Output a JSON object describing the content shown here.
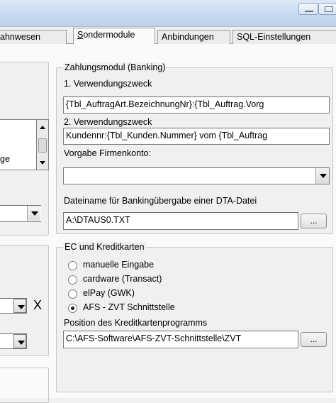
{
  "tabs": [
    {
      "label": "ahnwesen"
    },
    {
      "label_first": "S",
      "label_rest": "ondermodule"
    },
    {
      "label": "Anbindungen"
    },
    {
      "label": "SQL-Einstellungen"
    }
  ],
  "left": {
    "list_fragment": "ge",
    "close_glyph": "X"
  },
  "banking": {
    "legend": "Zahlungsmodul (Banking)",
    "purpose1_label": "1. Verwendungszweck",
    "purpose1_value": "{Tbl_AuftragArt.BezeichnungNr}:{Tbl_Auftrag.Vorg",
    "purpose2_label": "2. Verwendungszweck",
    "purpose2_value": "Kundennr:{Tbl_Kunden.Nummer} vom {Tbl_Auftrag",
    "account_label": "Vorgabe Firmenkonto:",
    "account_value": "",
    "filename_label": "Dateiname für Bankingübergabe einer DTA-Datei",
    "filename_value": "A:\\DTAUS0.TXT",
    "browse_label": "..."
  },
  "ec": {
    "legend": "EC und Kreditkarten",
    "options": [
      {
        "label": "manuelle Eingabe",
        "selected": false
      },
      {
        "label": "cardware (Transact)",
        "selected": false
      },
      {
        "label": "elPay (GWK)",
        "selected": false
      },
      {
        "label": "AFS - ZVT Schnittstelle",
        "selected": true
      }
    ],
    "path_label": "Position des Kreditkartenprogramms",
    "path_value": "C:\\AFS-Software\\AFS-ZVT-Schnittstelle\\ZVT",
    "browse_label": "..."
  }
}
